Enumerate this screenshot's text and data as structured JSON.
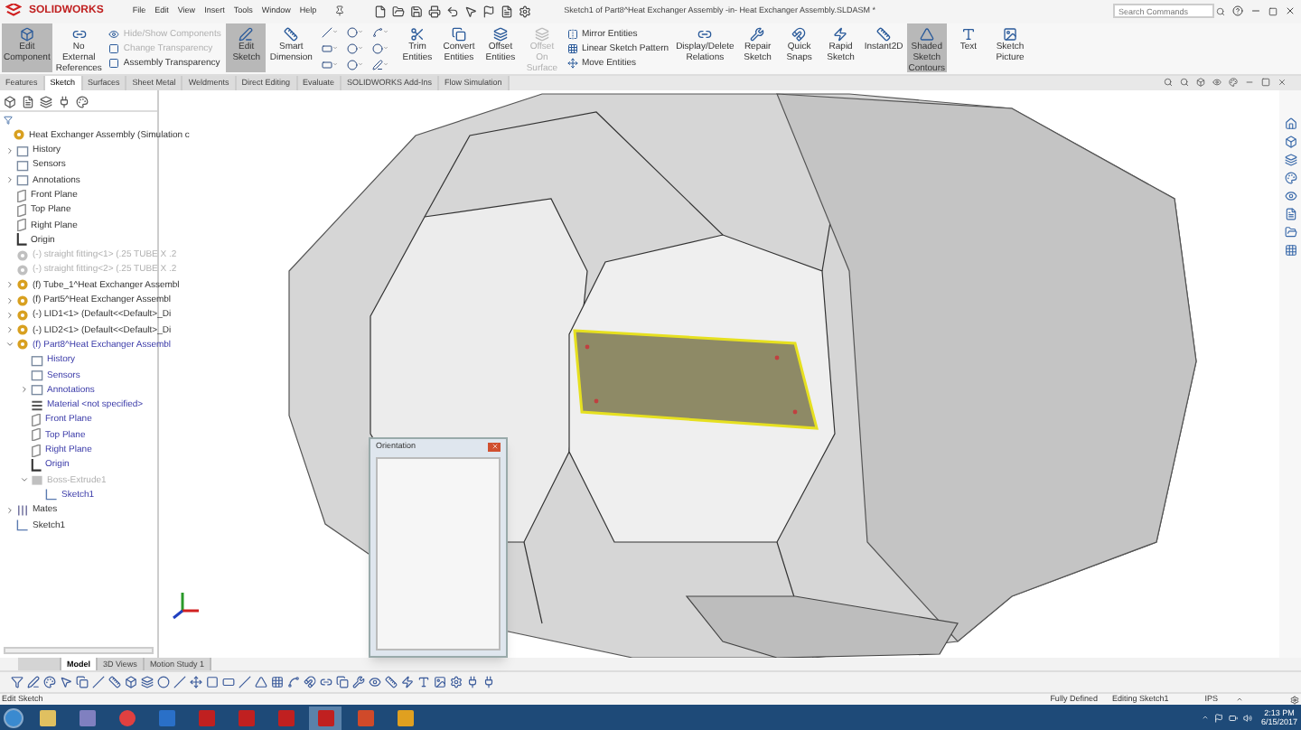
{
  "app": {
    "logo": "SOLIDWORKS",
    "menus": [
      "File",
      "Edit",
      "View",
      "Insert",
      "Tools",
      "Window",
      "Help"
    ],
    "title": "Sketch1 of Part8^Heat Exchanger Assembly -in- Heat Exchanger Assembly.SLDASM *",
    "search": {
      "placeholder": "Search Commands"
    }
  },
  "ribbon": [
    {
      "kind": "large",
      "label": "Edit Component",
      "selected": true,
      "disabled": false
    },
    {
      "kind": "large",
      "label": "No External References",
      "selected": false,
      "disabled": false
    },
    {
      "kind": "stack",
      "items": [
        {
          "label": "Hide/Show Components",
          "disabled": true
        },
        {
          "label": "Change Transparency",
          "disabled": true
        },
        {
          "label": "Assembly Transparency",
          "disabled": false
        }
      ]
    },
    {
      "kind": "large",
      "label": "Edit Sketch",
      "selected": true,
      "disabled": false
    },
    {
      "kind": "large",
      "label": "Smart Dimension",
      "selected": false,
      "disabled": false
    },
    {
      "kind": "tools"
    },
    {
      "kind": "large",
      "label": "Trim Entities",
      "selected": false,
      "disabled": false
    },
    {
      "kind": "large",
      "label": "Convert Entities",
      "selected": false,
      "disabled": false
    },
    {
      "kind": "large",
      "label": "Offset Entities",
      "selected": false,
      "disabled": false
    },
    {
      "kind": "large",
      "label": "Offset On Surface",
      "selected": false,
      "disabled": true
    },
    {
      "kind": "stack",
      "items": [
        {
          "label": "Mirror Entities",
          "disabled": false
        },
        {
          "label": "Linear Sketch Pattern",
          "disabled": false
        },
        {
          "label": "Move Entities",
          "disabled": false
        }
      ]
    },
    {
      "kind": "large",
      "label": "Display/Delete Relations",
      "selected": false,
      "disabled": false
    },
    {
      "kind": "large",
      "label": "Repair Sketch",
      "selected": false,
      "disabled": false
    },
    {
      "kind": "large",
      "label": "Quick Snaps",
      "selected": false,
      "disabled": false
    },
    {
      "kind": "large",
      "label": "Rapid Sketch",
      "selected": false,
      "disabled": false
    },
    {
      "kind": "large",
      "label": "Instant2D",
      "selected": false,
      "disabled": false
    },
    {
      "kind": "large",
      "label": "Shaded Sketch Contours",
      "selected": true,
      "disabled": false
    },
    {
      "kind": "large",
      "label": "Text",
      "selected": false,
      "disabled": false
    },
    {
      "kind": "large",
      "label": "Sketch Picture",
      "selected": false,
      "disabled": false
    }
  ],
  "tabs": [
    {
      "label": "Features",
      "selected": false
    },
    {
      "label": "Sketch",
      "selected": true
    },
    {
      "label": "Surfaces",
      "selected": false
    },
    {
      "label": "Sheet Metal",
      "selected": false
    },
    {
      "label": "Weldments",
      "selected": false
    },
    {
      "label": "Direct Editing",
      "selected": false
    },
    {
      "label": "Evaluate",
      "selected": false
    },
    {
      "label": "SOLIDWORKS Add-Ins",
      "selected": false
    },
    {
      "label": "Flow Simulation",
      "selected": false
    }
  ],
  "tree": {
    "label": "Heat Exchanger Assembly  (Simulation c",
    "kind": "assembly",
    "children": [
      {
        "label": "History",
        "kind": "folder",
        "expanded": false
      },
      {
        "label": "Sensors",
        "kind": "folder"
      },
      {
        "label": "Annotations",
        "kind": "folder",
        "expanded": false
      },
      {
        "label": "Front Plane",
        "kind": "plane"
      },
      {
        "label": "Top Plane",
        "kind": "plane"
      },
      {
        "label": "Right Plane",
        "kind": "plane"
      },
      {
        "label": "Origin",
        "kind": "origin"
      },
      {
        "label": "(-) straight fitting<1> (.25 TUBE X .2",
        "kind": "part",
        "disabled": true
      },
      {
        "label": "(-) straight fitting<2> (.25 TUBE X .2",
        "kind": "part",
        "disabled": true
      },
      {
        "label": "(f) Tube_1^Heat Exchanger Assembl",
        "kind": "part",
        "expanded": false
      },
      {
        "label": "(f) Part5^Heat Exchanger Assembl",
        "kind": "part",
        "expanded": false
      },
      {
        "label": "(-) LID1<1> (Default<<Default>_Di",
        "kind": "part",
        "expanded": false
      },
      {
        "label": "(-) LID2<1> (Default<<Default>_Di",
        "kind": "part",
        "expanded": false
      },
      {
        "label": "(f) Part8^Heat Exchanger Assembl",
        "kind": "part",
        "expanded": true,
        "active": true,
        "children": [
          {
            "label": "History",
            "kind": "folder"
          },
          {
            "label": "Sensors",
            "kind": "folder"
          },
          {
            "label": "Annotations",
            "kind": "folder",
            "expanded": false
          },
          {
            "label": "Material <not specified>",
            "kind": "material"
          },
          {
            "label": "Front Plane",
            "kind": "plane"
          },
          {
            "label": "Top Plane",
            "kind": "plane"
          },
          {
            "label": "Right Plane",
            "kind": "plane"
          },
          {
            "label": "Origin",
            "kind": "origin"
          },
          {
            "label": "Boss-Extrude1",
            "kind": "feature",
            "expanded": true,
            "disabled": true,
            "children": [
              {
                "label": "Sketch1",
                "kind": "sketch"
              }
            ]
          }
        ]
      },
      {
        "label": "Mates",
        "kind": "mates",
        "expanded": false
      },
      {
        "label": "Sketch1",
        "kind": "sketch"
      }
    ]
  },
  "orientation_dialog": {
    "title": "Orientation"
  },
  "bottom_tabs": [
    {
      "selected": false
    },
    {
      "label": "Model",
      "selected": true
    },
    {
      "label": "3D Views",
      "selected": false
    },
    {
      "label": "Motion Study 1",
      "selected": false
    }
  ],
  "status_bar": {
    "mode": "Edit Sketch",
    "state": "Fully Defined",
    "editing": "Editing Sketch1",
    "units": "IPS"
  },
  "taskbar": {
    "apps": [
      {
        "kind": "explorer",
        "selected": false
      },
      {
        "kind": "tool",
        "selected": false
      },
      {
        "kind": "browser",
        "selected": false
      },
      {
        "kind": "mail",
        "selected": false
      },
      {
        "kind": "cad",
        "selected": false
      },
      {
        "kind": "cad",
        "selected": false
      },
      {
        "kind": "cad",
        "selected": false
      },
      {
        "kind": "cad",
        "selected": true
      },
      {
        "kind": "slides",
        "selected": false
      },
      {
        "kind": "app",
        "selected": false
      }
    ],
    "time": "2:13 PM",
    "date": "6/15/2017"
  }
}
